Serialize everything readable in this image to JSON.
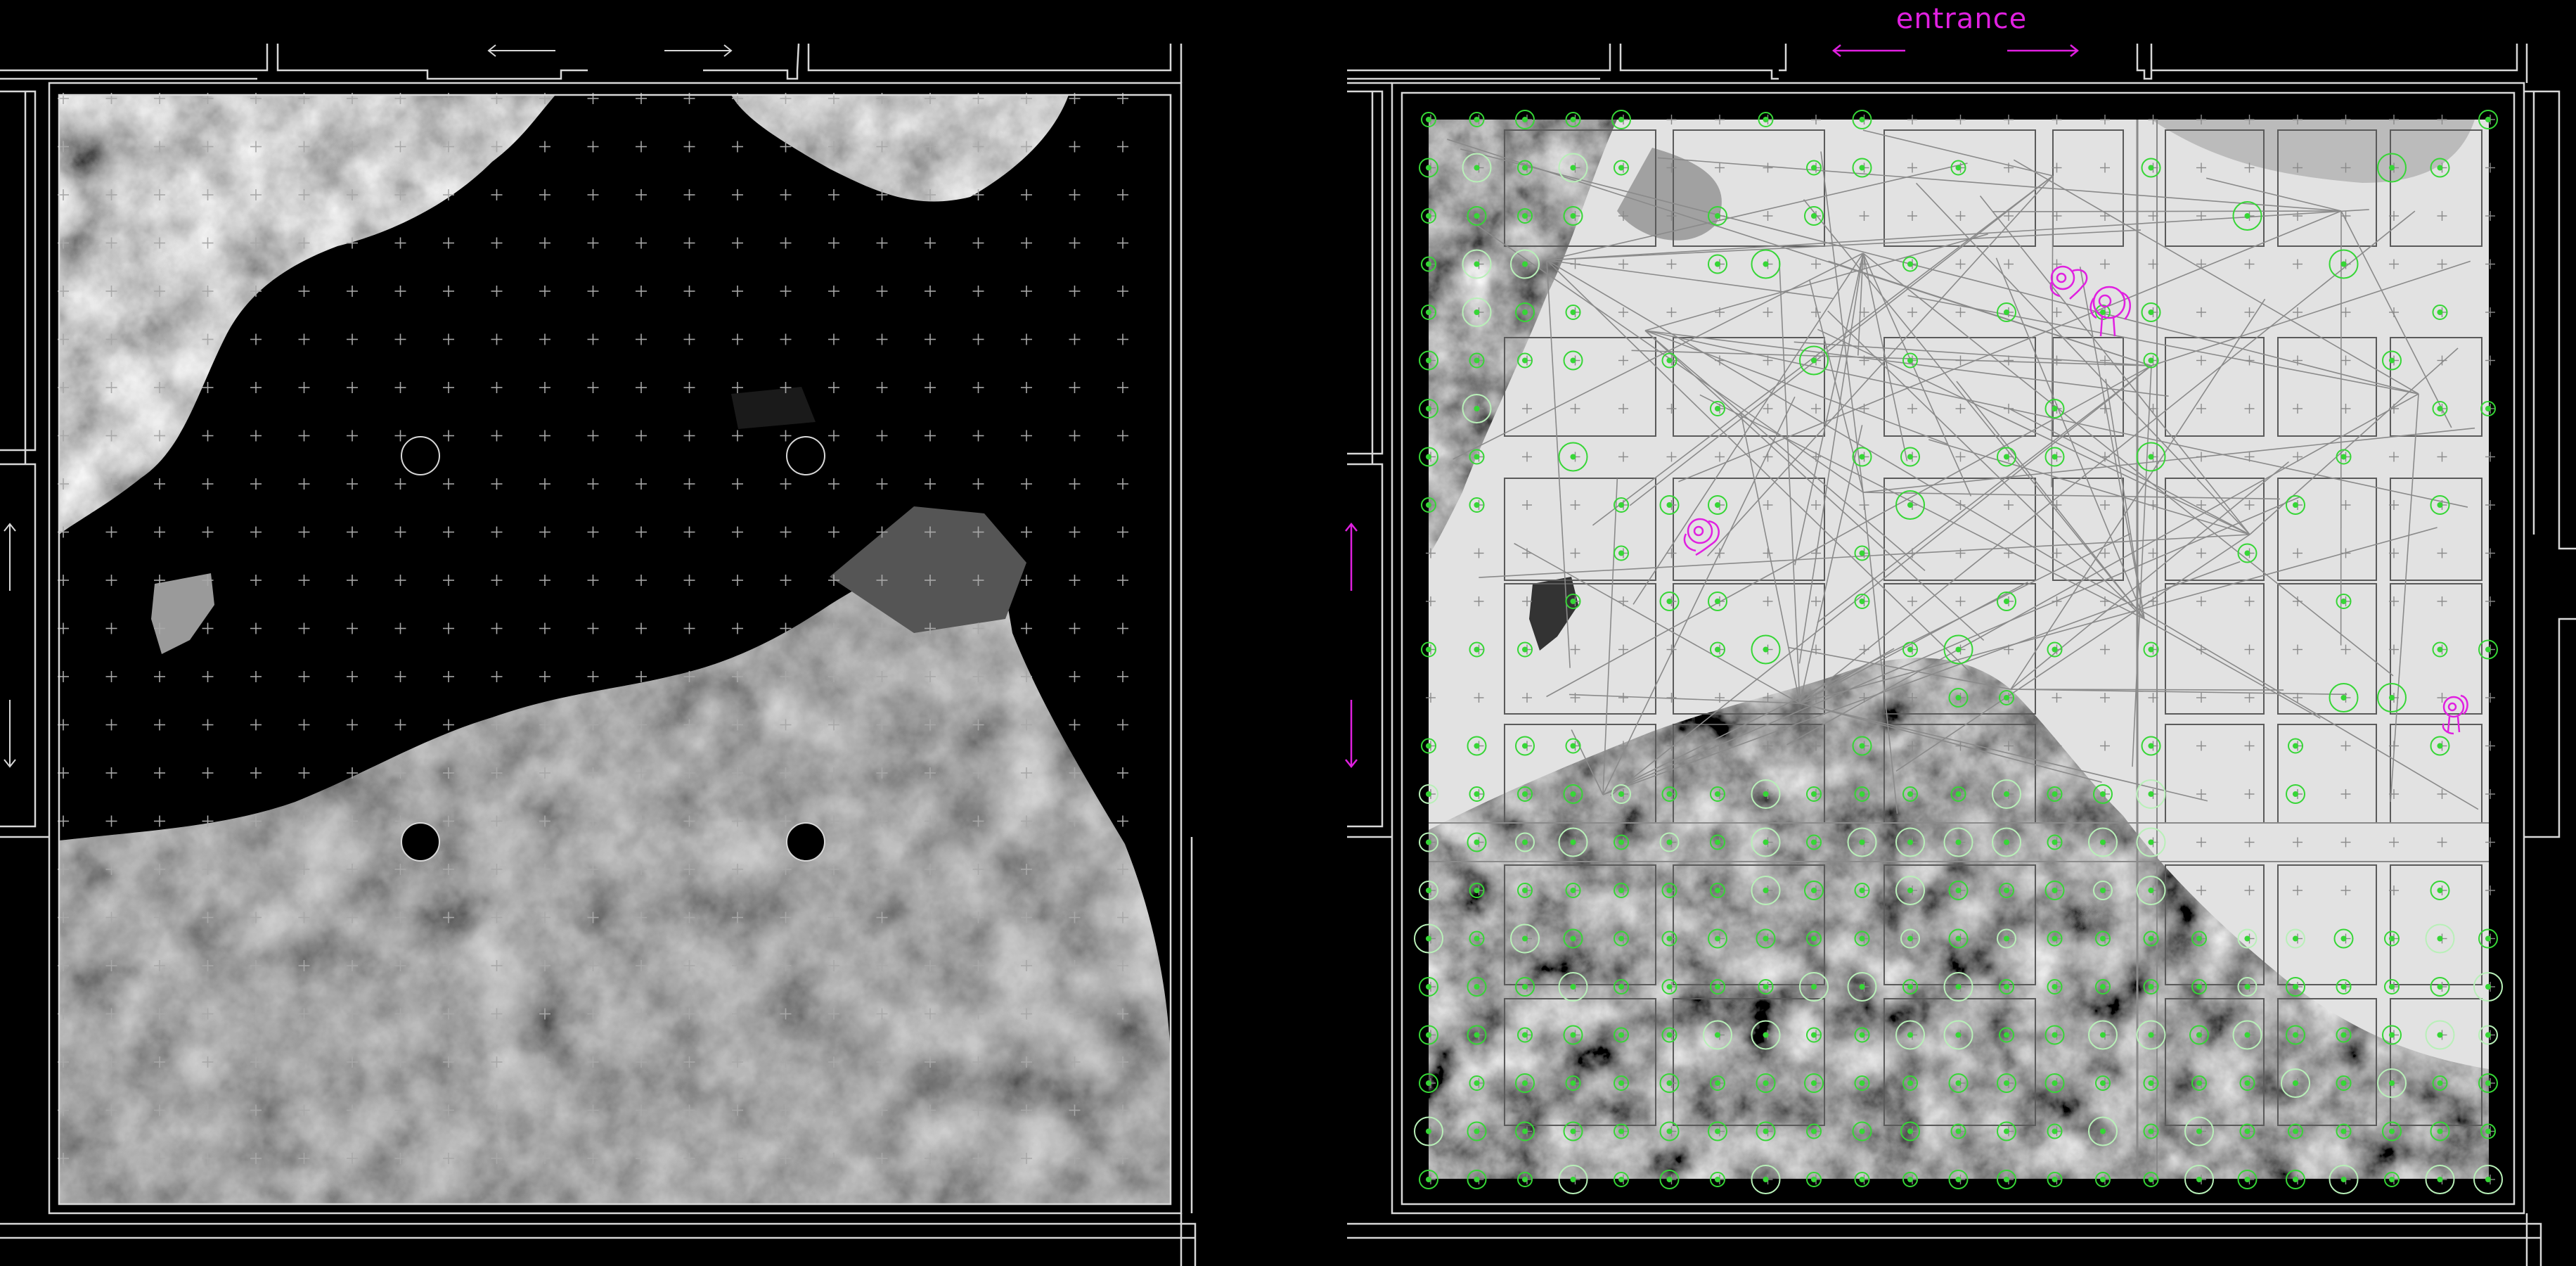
{
  "labels": {
    "entrance": "entrance"
  },
  "colors": {
    "background": "#000000",
    "wall_line": "#d8d8d8",
    "grid_cross": "#a8a8a8",
    "accent_magenta": "#e020e0",
    "node_green": "#36d636",
    "node_light": "#b8f0b8",
    "network_line": "#8a8a8a",
    "floor_light": "#e2e2e2"
  },
  "icons": {
    "arrow": "arrow-icon",
    "figure": "visitor-figure-icon",
    "column": "column-icon"
  }
}
